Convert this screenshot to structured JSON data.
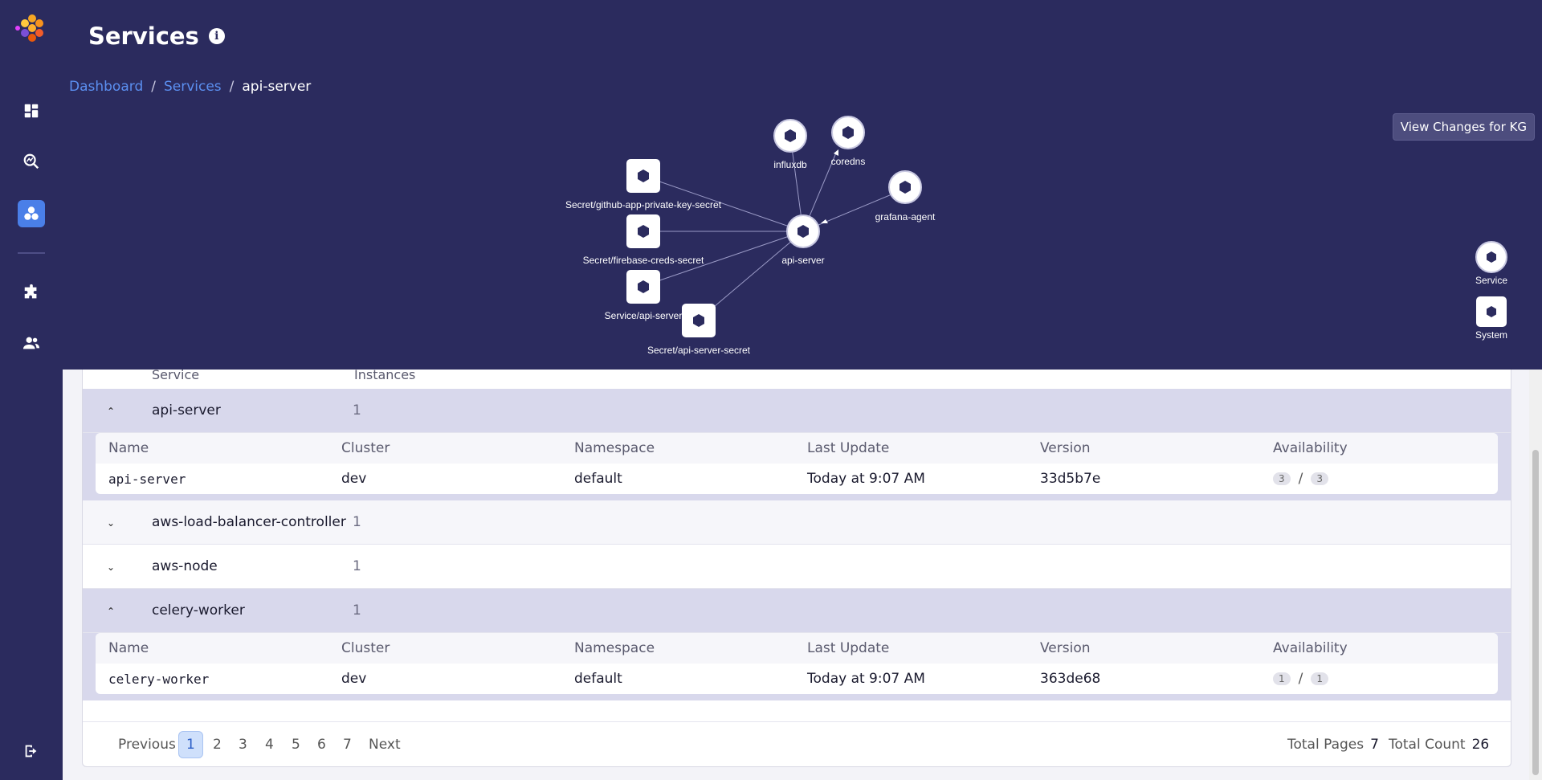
{
  "header": {
    "title": "Services",
    "info_symbol": "i"
  },
  "breadcrumb": {
    "items": [
      "Dashboard",
      "Services",
      "api-server"
    ],
    "separator": "/"
  },
  "kg_button": {
    "label": "View Changes for KG"
  },
  "graph": {
    "nodes": [
      {
        "label": "influxdb",
        "shape": "circle"
      },
      {
        "label": "coredns",
        "shape": "circle"
      },
      {
        "label": "grafana-agent",
        "shape": "circle"
      },
      {
        "label": "api-server",
        "shape": "circle"
      },
      {
        "label": "Secret/github-app-private-key-secret",
        "shape": "square"
      },
      {
        "label": "Secret/firebase-creds-secret",
        "shape": "square"
      },
      {
        "label": "Service/api-server",
        "shape": "square"
      },
      {
        "label": "Secret/api-server-secret",
        "shape": "square"
      }
    ],
    "legend": [
      {
        "label": "Service",
        "shape": "circle"
      },
      {
        "label": "System",
        "shape": "square"
      }
    ]
  },
  "table": {
    "columns": {
      "service": "Service",
      "instances": "Instances"
    },
    "detail_columns": [
      "Name",
      "Cluster",
      "Namespace",
      "Last Update",
      "Version",
      "Availability"
    ],
    "groups": [
      {
        "name": "api-server",
        "count": "1",
        "expanded": true,
        "rows": [
          {
            "name": "api-server",
            "cluster": "dev",
            "namespace": "default",
            "last_update": "Today at 9:07 AM",
            "version": "33d5b7e",
            "avail_a": "3",
            "avail_b": "3",
            "avail_sep": "/"
          }
        ]
      },
      {
        "name": "aws-load-balancer-controller",
        "count": "1",
        "expanded": false
      },
      {
        "name": "aws-node",
        "count": "1",
        "expanded": false
      },
      {
        "name": "celery-worker",
        "count": "1",
        "expanded": true,
        "rows": [
          {
            "name": "celery-worker",
            "cluster": "dev",
            "namespace": "default",
            "last_update": "Today at 9:07 AM",
            "version": "363de68",
            "avail_a": "1",
            "avail_b": "1",
            "avail_sep": "/"
          }
        ]
      }
    ]
  },
  "pagination": {
    "previous": "Previous",
    "pages": [
      "1",
      "2",
      "3",
      "4",
      "5",
      "6",
      "7"
    ],
    "current": "1",
    "next": "Next",
    "total_pages_label": "Total Pages",
    "total_pages": "7",
    "total_count_label": "Total Count",
    "total_count": "26"
  },
  "colors": {
    "background": "#2b2b5e",
    "accent": "#4a7fe8",
    "expanded_row": "#d8d8ec"
  }
}
